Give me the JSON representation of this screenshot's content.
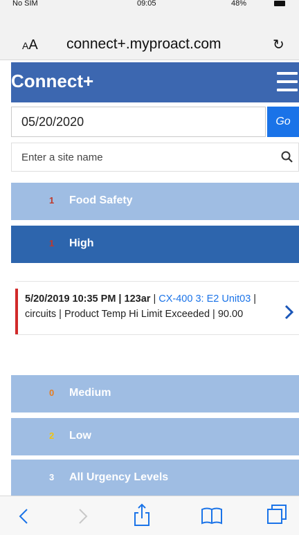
{
  "status_bar": {
    "carrier": "No SIM",
    "time": "09:05",
    "battery": "48%"
  },
  "browser": {
    "text_size_label": "AA",
    "url": "connect+.myproact.com"
  },
  "app": {
    "title": "Connect+",
    "menu_icon": "hamburger-menu-icon"
  },
  "date_filter": {
    "value": "05/20/2020",
    "go_label": "Go"
  },
  "site_search": {
    "placeholder": "Enter a site name"
  },
  "categories": [
    {
      "count": "1",
      "label": "Food Safety",
      "count_color": "#c0392b"
    },
    {
      "count": "1",
      "label": "High",
      "count_color": "#c0392b"
    },
    {
      "count": "0",
      "label": "Medium",
      "count_color": "#e67e22"
    },
    {
      "count": "2",
      "label": "Low",
      "count_color": "#f1c40f"
    },
    {
      "count": "3",
      "label": "All Urgency Levels",
      "count_color": "#ffffff"
    }
  ],
  "alarm": {
    "datetime": "5/20/2019 10:35 PM",
    "sep1": " | ",
    "site": "123ar",
    "sep2": " | ",
    "device": "CX-400 3: E2 Unit03",
    "rest": " | circuits | Product Temp Hi Limit Exceeded | 90.00",
    "urgency_color": "#d12a2a"
  },
  "colors": {
    "app_bar": "#3c67b0",
    "accordion_light": "#9fbde3",
    "accordion_dark": "#2d65ad",
    "link": "#1a73e8"
  }
}
